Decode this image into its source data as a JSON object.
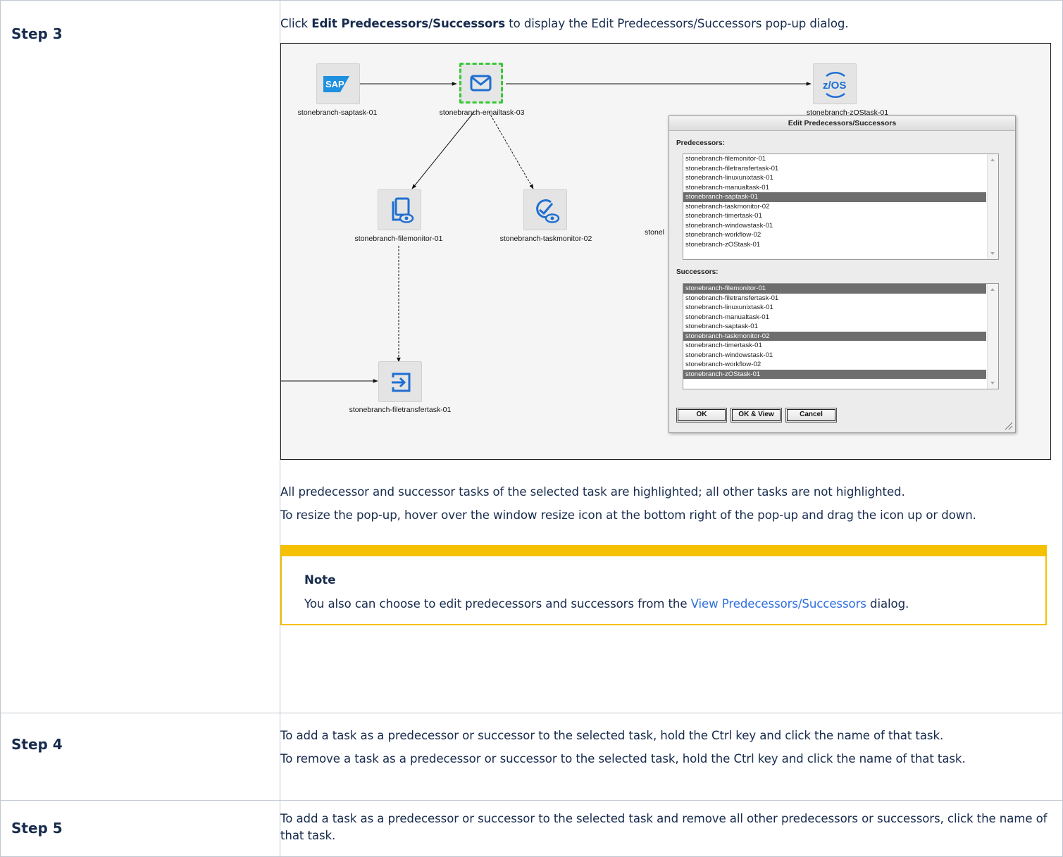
{
  "steps": [
    {
      "label": "Step 3",
      "intro_prefix": "Click ",
      "intro_bold": "Edit Predecessors/Successors",
      "intro_suffix": " to display the Edit Predecessors/Successors pop-up dialog.",
      "after": [
        "All predecessor and successor tasks of the selected task are highlighted; all other tasks are not highlighted.",
        "To resize the pop-up, hover over the window resize icon at the bottom right of the pop-up and drag the icon up or down."
      ],
      "note": {
        "title": "Note",
        "text_before": "You also can choose to edit predecessors and successors from the ",
        "link": "View Predecessors/Successors",
        "text_after": " dialog."
      }
    },
    {
      "label": "Step 4",
      "paras": [
        "To add a task as a predecessor or successor to the selected task, hold the Ctrl key and click the name of that task.",
        "To remove a task as a predecessor or successor to the selected task, hold the Ctrl key and click the name of that task."
      ]
    },
    {
      "label": "Step 5",
      "paras": [
        "To add a task as a predecessor or successor to the selected task and remove all other predecessors or successors, click the name of that task."
      ]
    }
  ],
  "workflow": {
    "nodes": {
      "saptask": {
        "label": "stonebranch-saptask-01",
        "icon": "sap-logo-icon"
      },
      "emailtask": {
        "label": "stonebranch-emailtask-03",
        "icon": "envelope-icon",
        "selected": true
      },
      "zostask": {
        "label": "stonebranch-zOStask-01",
        "icon": "zos-icon"
      },
      "filemonitor": {
        "label": "stonebranch-filemonitor-01",
        "icon": "file-monitor-icon"
      },
      "taskmonitor": {
        "label": "stonebranch-taskmonitor-02",
        "icon": "task-monitor-icon"
      },
      "filetransfer": {
        "label": "stonebranch-filetransfertask-01",
        "icon": "file-transfer-icon"
      },
      "partial_label": "stonel",
      "sap_text": "SAP",
      "zos_text": "z/OS"
    },
    "dialog": {
      "title": "Edit Predecessors/Successors",
      "predecessors_label": "Predecessors:",
      "successors_label": "Successors:",
      "predecessors": [
        {
          "name": "stonebranch-filemonitor-01",
          "selected": false
        },
        {
          "name": "stonebranch-filetransfertask-01",
          "selected": false
        },
        {
          "name": "stonebranch-linuxunixtask-01",
          "selected": false
        },
        {
          "name": "stonebranch-manualtask-01",
          "selected": false
        },
        {
          "name": "stonebranch-saptask-01",
          "selected": true
        },
        {
          "name": "stonebranch-taskmonitor-02",
          "selected": false
        },
        {
          "name": "stonebranch-timertask-01",
          "selected": false
        },
        {
          "name": "stonebranch-windowstask-01",
          "selected": false
        },
        {
          "name": "stonebranch-workflow-02",
          "selected": false
        },
        {
          "name": "stonebranch-zOStask-01",
          "selected": false
        }
      ],
      "successors": [
        {
          "name": "stonebranch-filemonitor-01",
          "selected": true
        },
        {
          "name": "stonebranch-filetransfertask-01",
          "selected": false
        },
        {
          "name": "stonebranch-linuxunixtask-01",
          "selected": false
        },
        {
          "name": "stonebranch-manualtask-01",
          "selected": false
        },
        {
          "name": "stonebranch-saptask-01",
          "selected": false
        },
        {
          "name": "stonebranch-taskmonitor-02",
          "selected": true
        },
        {
          "name": "stonebranch-timertask-01",
          "selected": false
        },
        {
          "name": "stonebranch-windowstask-01",
          "selected": false
        },
        {
          "name": "stonebranch-workflow-02",
          "selected": false
        },
        {
          "name": "stonebranch-zOStask-01",
          "selected": true
        }
      ],
      "buttons": {
        "ok": "OK",
        "ok_view": "OK & View",
        "cancel": "Cancel"
      }
    }
  },
  "colors": {
    "selection_dash": "#36c936",
    "note_accent": "#f5c000",
    "link": "#2f6fde",
    "icon_blue": "#1f6fd1",
    "list_highlight": "#6e6e6e"
  }
}
